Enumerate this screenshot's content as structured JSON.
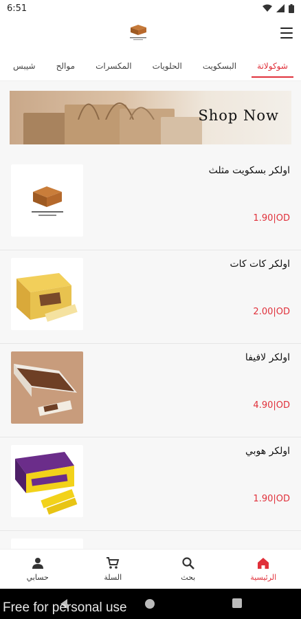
{
  "status_bar": {
    "time": "6:51"
  },
  "tabs": [
    {
      "label": "شوكولاتة",
      "active": true
    },
    {
      "label": "البسكويت",
      "active": false
    },
    {
      "label": "الحلويات",
      "active": false
    },
    {
      "label": "المكسرات",
      "active": false
    },
    {
      "label": "موالح",
      "active": false
    },
    {
      "label": "شيبس",
      "active": false
    }
  ],
  "banner": {
    "text": "Shop Now"
  },
  "products": [
    {
      "name": "اولكر بسكويت مثلث",
      "price": "1.90|OD",
      "thumb": "kandeen-logo-icon"
    },
    {
      "name": "اولكر كات كات",
      "price": "2.00|OD",
      "thumb": "yellow-box-icon"
    },
    {
      "name": "اولكر لافيفا",
      "price": "4.90|OD",
      "thumb": "brown-box-icon"
    },
    {
      "name": "اولكر هوبي",
      "price": "1.90|OD",
      "thumb": "purple-box-icon"
    }
  ],
  "bottom_nav": [
    {
      "label": "الرئيسية",
      "icon": "home-icon",
      "active": true
    },
    {
      "label": "بحث",
      "icon": "search-icon",
      "active": false
    },
    {
      "label": "السلة",
      "icon": "cart-icon",
      "active": false
    },
    {
      "label": "حسابي",
      "icon": "person-icon",
      "active": false
    }
  ],
  "watermark": "Free for personal use",
  "colors": {
    "accent": "#e0303a",
    "background": "#f7f7f7"
  }
}
